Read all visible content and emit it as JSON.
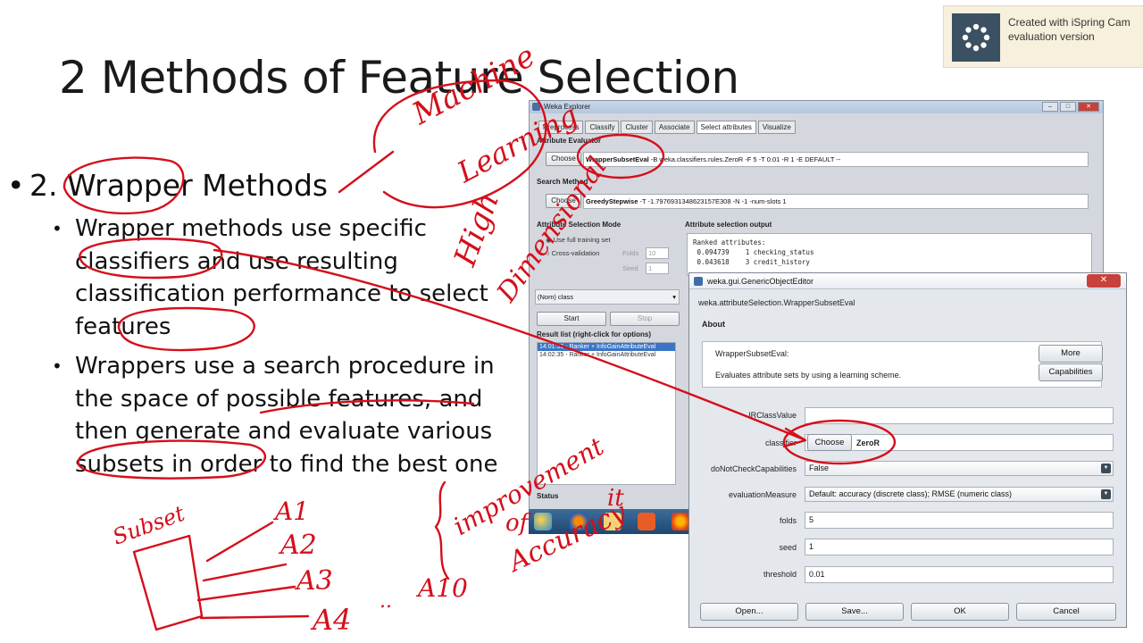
{
  "slide": {
    "title": "2 Methods of Feature Selection",
    "heading": "2. Wrapper Methods",
    "bullets": [
      "Wrapper methods use specific classifiers and use resulting classification performance to select features",
      "Wrappers use a search procedure in the space of possible features, and then generate and evaluate various subsets in order to find the best one"
    ]
  },
  "watermark": {
    "line1": "Created with iSpring Cam",
    "line2": "evaluation version"
  },
  "weka_explorer": {
    "title": "Weka Explorer",
    "tabs": [
      "Preprocess",
      "Classify",
      "Cluster",
      "Associate",
      "Select attributes",
      "Visualize"
    ],
    "active_tab": "Select attributes",
    "attribute_evaluator_label": "Attribute Evaluator",
    "evaluator_choose": "Choose",
    "evaluator_name": "WrapperSubsetEval",
    "evaluator_args": "-B weka.classifiers.rules.ZeroR -F 5 -T 0.01 -R 1 -E DEFAULT --",
    "search_method_label": "Search Method",
    "search_choose": "Choose",
    "search_name": "GreedyStepwise",
    "search_args": "-T -1.7976931348623157E308 -N -1 -num-slots 1",
    "selection_mode_label": "Attribute Selection Mode",
    "mode_full": "Use full training set",
    "mode_cv": "Cross-validation",
    "folds_label": "Folds",
    "folds_value": "10",
    "seed_label": "Seed",
    "seed_value": "1",
    "class_select": "(Nom) class",
    "start_button": "Start",
    "stop_button": "Stop",
    "result_list_label": "Result list (right-click for options)",
    "results": [
      "14:01:59 - Ranker + InfoGainAttributeEval",
      "14:02:35 - Ranker + InfoGainAttributeEval"
    ],
    "output_label": "Attribute selection output",
    "output_lines": [
      "Ranked attributes:",
      " 0.094739    1 checking_status",
      " 0.043618    3 credit_history"
    ],
    "status_label": "Status"
  },
  "object_editor": {
    "title": "weka.gui.GenericObjectEditor",
    "class_path": "weka.attributeSelection.WrapperSubsetEval",
    "about_label": "About",
    "about_name": "WrapperSubsetEval:",
    "about_desc": "Evaluates attribute sets by using a learning scheme.",
    "more_button": "More",
    "capabilities_button": "Capabilities",
    "fields": [
      {
        "label": "IRClassValue",
        "value": ""
      },
      {
        "label": "classifier",
        "value": "ZeroR",
        "button": "Choose"
      },
      {
        "label": "doNotCheckCapabilities",
        "value": "False"
      },
      {
        "label": "evaluationMeasure",
        "value": "Default: accuracy (discrete class); RMSE (numeric class)"
      },
      {
        "label": "folds",
        "value": "5"
      },
      {
        "label": "seed",
        "value": "1"
      },
      {
        "label": "threshold",
        "value": "0.01"
      }
    ],
    "open_button": "Open...",
    "save_button": "Save...",
    "ok_button": "OK",
    "cancel_button": "Cancel"
  },
  "annotations": {
    "machine_learning": [
      "Machine",
      "Learning"
    ],
    "high_dimensional": [
      "High",
      "Dimensional"
    ],
    "improvement": [
      "improvement",
      "of",
      "Accuracy"
    ],
    "subset": "Subset",
    "a1": "A1",
    "a2": "A2",
    "a3": "A3",
    "a4": "A4",
    "a10": "A10",
    "dots": "..",
    "it": "it"
  },
  "colors": {
    "ink": "#d40f1b",
    "accent": "#3b5063"
  }
}
